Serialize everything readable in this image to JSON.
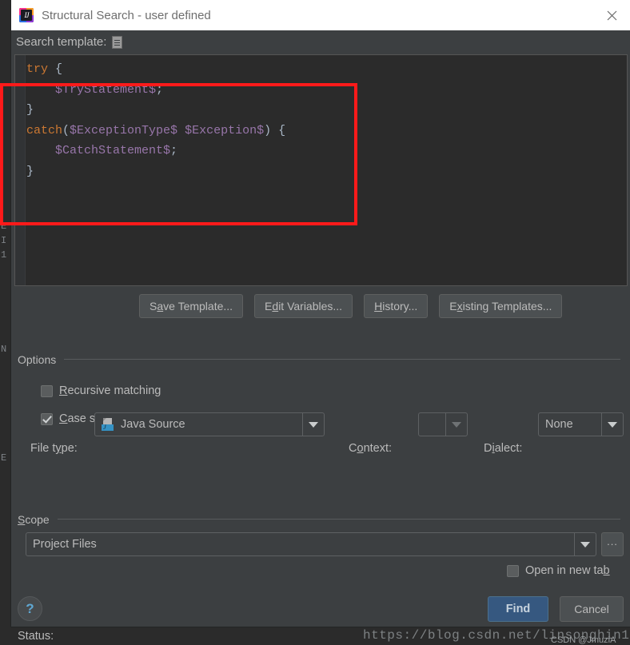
{
  "window": {
    "title": "Structural Search - user defined",
    "app_icon": "intellij-idea-icon",
    "close_icon": "close-icon"
  },
  "search_template": {
    "label": "Search template:",
    "icon": "template-document-icon",
    "code_lines": [
      {
        "tokens": [
          {
            "t": "try",
            "c": "kw"
          },
          {
            "t": " {",
            "c": "pun"
          }
        ]
      },
      {
        "tokens": [
          {
            "t": "    ",
            "c": "pun"
          },
          {
            "t": "$TryStatement$",
            "c": "var"
          },
          {
            "t": ";",
            "c": "pun"
          }
        ]
      },
      {
        "tokens": [
          {
            "t": "}",
            "c": "pun"
          }
        ]
      },
      {
        "tokens": [
          {
            "t": "catch",
            "c": "kw"
          },
          {
            "t": "(",
            "c": "pun"
          },
          {
            "t": "$ExceptionType$",
            "c": "var"
          },
          {
            "t": " ",
            "c": "pun"
          },
          {
            "t": "$Exception$",
            "c": "var"
          },
          {
            "t": ") {",
            "c": "pun"
          }
        ]
      },
      {
        "tokens": [
          {
            "t": "    ",
            "c": "pun"
          },
          {
            "t": "$CatchStatement$",
            "c": "var"
          },
          {
            "t": ";",
            "c": "pun"
          }
        ]
      },
      {
        "tokens": [
          {
            "t": "}",
            "c": "pun"
          }
        ]
      }
    ]
  },
  "template_buttons": [
    {
      "name": "save-template-button",
      "pre": "S",
      "mnemonic": "a",
      "post": "ve Template..."
    },
    {
      "name": "edit-variables-button",
      "pre": "E",
      "mnemonic": "d",
      "post": "it Variables..."
    },
    {
      "name": "history-button",
      "pre": "",
      "mnemonic": "H",
      "post": "istory..."
    },
    {
      "name": "existing-templates-button",
      "pre": "E",
      "mnemonic": "x",
      "post": "isting Templates..."
    }
  ],
  "options": {
    "title": "Options",
    "recursive_matching": {
      "pre": "",
      "mnemonic": "R",
      "post": "ecursive matching",
      "checked": false
    },
    "case_sensitive": {
      "pre": "",
      "mnemonic": "C",
      "post": "ase sensitive",
      "checked": true
    },
    "file_type": {
      "label_pre": "File t",
      "label_mnemonic": "y",
      "label_post": "pe:",
      "value": "Java Source",
      "icon": "java-source-file-icon"
    },
    "context": {
      "label_pre": "C",
      "label_mnemonic": "o",
      "label_post": "ntext:",
      "value": "",
      "enabled": false
    },
    "dialect": {
      "label_pre": "D",
      "label_mnemonic": "i",
      "label_post": "alect:",
      "value": "None",
      "enabled": true
    }
  },
  "scope": {
    "title_pre": "",
    "title_mnemonic": "S",
    "title_post": "cope",
    "value": "Project Files",
    "browse_label": "...",
    "open_in_new_tab": {
      "pre": "Open in new ta",
      "mnemonic": "b",
      "post": "",
      "checked": false
    }
  },
  "footer": {
    "help_icon": "help-question-icon",
    "status_label": "Status:",
    "find_label": "Find",
    "cancel_label": "Cancel"
  },
  "watermark": {
    "url": "https://blog.csdn.net/linsonghin1",
    "tag": "CSDN @JmuziA"
  },
  "background_fragments": [
    "E",
    "I",
    "1",
    "N",
    "E"
  ],
  "colors": {
    "dialog_bg": "#3c3f41",
    "editor_bg": "#2b2b2b",
    "titlebar_bg": "#ffffff",
    "text": "#bbbbbb",
    "keyword": "#cc7832",
    "variable": "#9876aa",
    "default_button": "#365880",
    "annotation": "#ff1a1a",
    "accent": "#3592c4"
  }
}
